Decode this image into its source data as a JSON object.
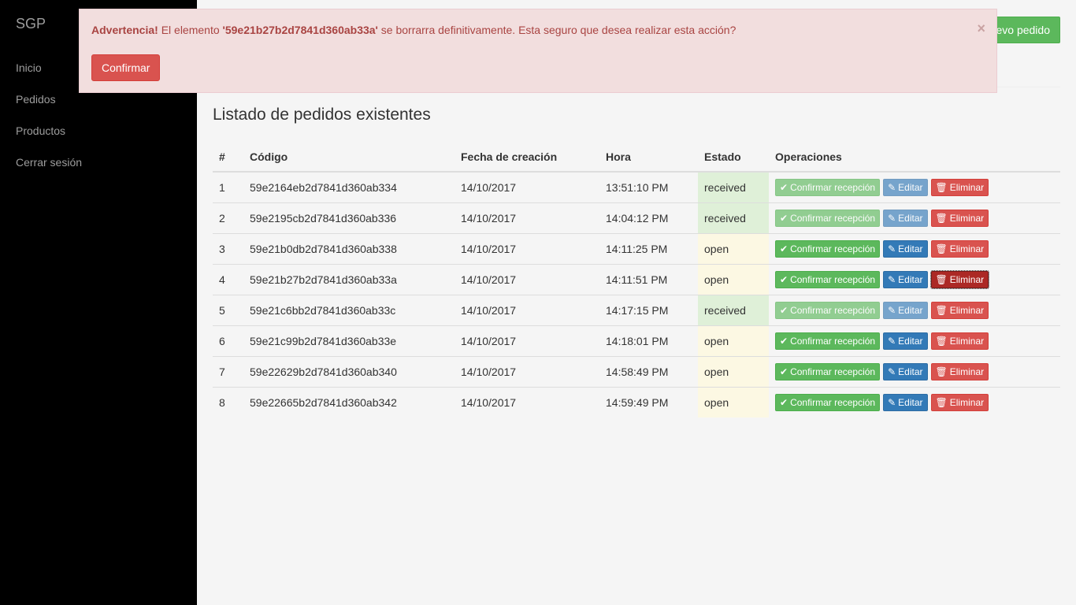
{
  "sidebar": {
    "brand": "SGP",
    "items": [
      {
        "label": "Inicio"
      },
      {
        "label": "Pedidos"
      },
      {
        "label": "Productos"
      },
      {
        "label": "Cerrar sesión"
      }
    ]
  },
  "header": {
    "new_button_label": "Nuevo pedido"
  },
  "alert": {
    "title": "Advertencia!",
    "text_before": " El elemento ",
    "element_id": "'59e21b27b2d7841d360ab33a'",
    "text_after": " se borrarra definitivamente. Esta seguro que desea realizar esta acción?",
    "close_label": "×",
    "confirm_label": "Confirmar",
    "colors": {
      "background": "#f2dede",
      "text": "#a94442",
      "confirm": "#d9534f"
    }
  },
  "main": {
    "title": "Listado de pedidos existentes",
    "columns": [
      "#",
      "Código",
      "Fecha de creación",
      "Hora",
      "Estado",
      "Operaciones"
    ],
    "buttons": {
      "confirm": "Confirmar recepción",
      "edit": "Editar",
      "delete": "Eliminar",
      "confirm_icon": "check-icon",
      "edit_icon": "edit-icon",
      "delete_icon": "trash-icon"
    },
    "rows": [
      {
        "n": "1",
        "code": "59e2164eb2d7841d360ab334",
        "date": "14/10/2017",
        "time": "13:51:10 PM",
        "status": "received"
      },
      {
        "n": "2",
        "code": "59e2195cb2d7841d360ab336",
        "date": "14/10/2017",
        "time": "14:04:12 PM",
        "status": "received"
      },
      {
        "n": "3",
        "code": "59e21b0db2d7841d360ab338",
        "date": "14/10/2017",
        "time": "14:11:25 PM",
        "status": "open"
      },
      {
        "n": "4",
        "code": "59e21b27b2d7841d360ab33a",
        "date": "14/10/2017",
        "time": "14:11:51 PM",
        "status": "open"
      },
      {
        "n": "5",
        "code": "59e21c6bb2d7841d360ab33c",
        "date": "14/10/2017",
        "time": "14:17:15 PM",
        "status": "received"
      },
      {
        "n": "6",
        "code": "59e21c99b2d7841d360ab33e",
        "date": "14/10/2017",
        "time": "14:18:01 PM",
        "status": "open"
      },
      {
        "n": "7",
        "code": "59e22629b2d7841d360ab340",
        "date": "14/10/2017",
        "time": "14:58:49 PM",
        "status": "open"
      },
      {
        "n": "8",
        "code": "59e22665b2d7841d360ab342",
        "date": "14/10/2017",
        "time": "14:59:49 PM",
        "status": "open"
      }
    ],
    "colors": {
      "received": "#dff0d8",
      "open": "#fcf8e3",
      "success": "#5cb85c",
      "primary": "#337ab7",
      "danger": "#d9534f"
    }
  }
}
